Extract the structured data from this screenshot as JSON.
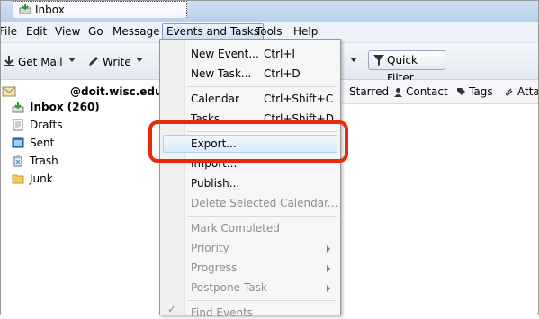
{
  "tab": {
    "title": "Inbox"
  },
  "menubar": [
    "File",
    "Edit",
    "View",
    "Go",
    "Message",
    "Events and Tasks",
    "Tools",
    "Help"
  ],
  "toolbar": {
    "get_mail": "Get Mail",
    "write": "Write",
    "quick_filter": "Quick Filter"
  },
  "account": {
    "name": "@doit.wisc.edu"
  },
  "folders": [
    "Inbox (260)",
    "Drafts",
    "Sent",
    "Trash",
    "Junk"
  ],
  "column_header": {
    "starred": "Starred",
    "contact": "Contact",
    "tags": "Tags",
    "attachment": "Atta"
  },
  "events_menu": {
    "new_event": "New Event...",
    "new_event_shortcut": "Ctrl+I",
    "new_task": "New Task...",
    "new_task_shortcut": "Ctrl+D",
    "calendar": "Calendar",
    "calendar_shortcut": "Ctrl+Shift+C",
    "tasks": "Tasks",
    "tasks_shortcut": "Ctrl+Shift+D",
    "export": "Export...",
    "import": "Import...",
    "publish": "Publish...",
    "delete_calendar": "Delete Selected Calendar...",
    "mark_completed": "Mark Completed",
    "priority": "Priority",
    "progress": "Progress",
    "postpone": "Postpone Task",
    "find_events": "Find Events"
  },
  "colors": {
    "accent_highlight": "#dcebfc",
    "annotation_ring": "#e8290b"
  }
}
